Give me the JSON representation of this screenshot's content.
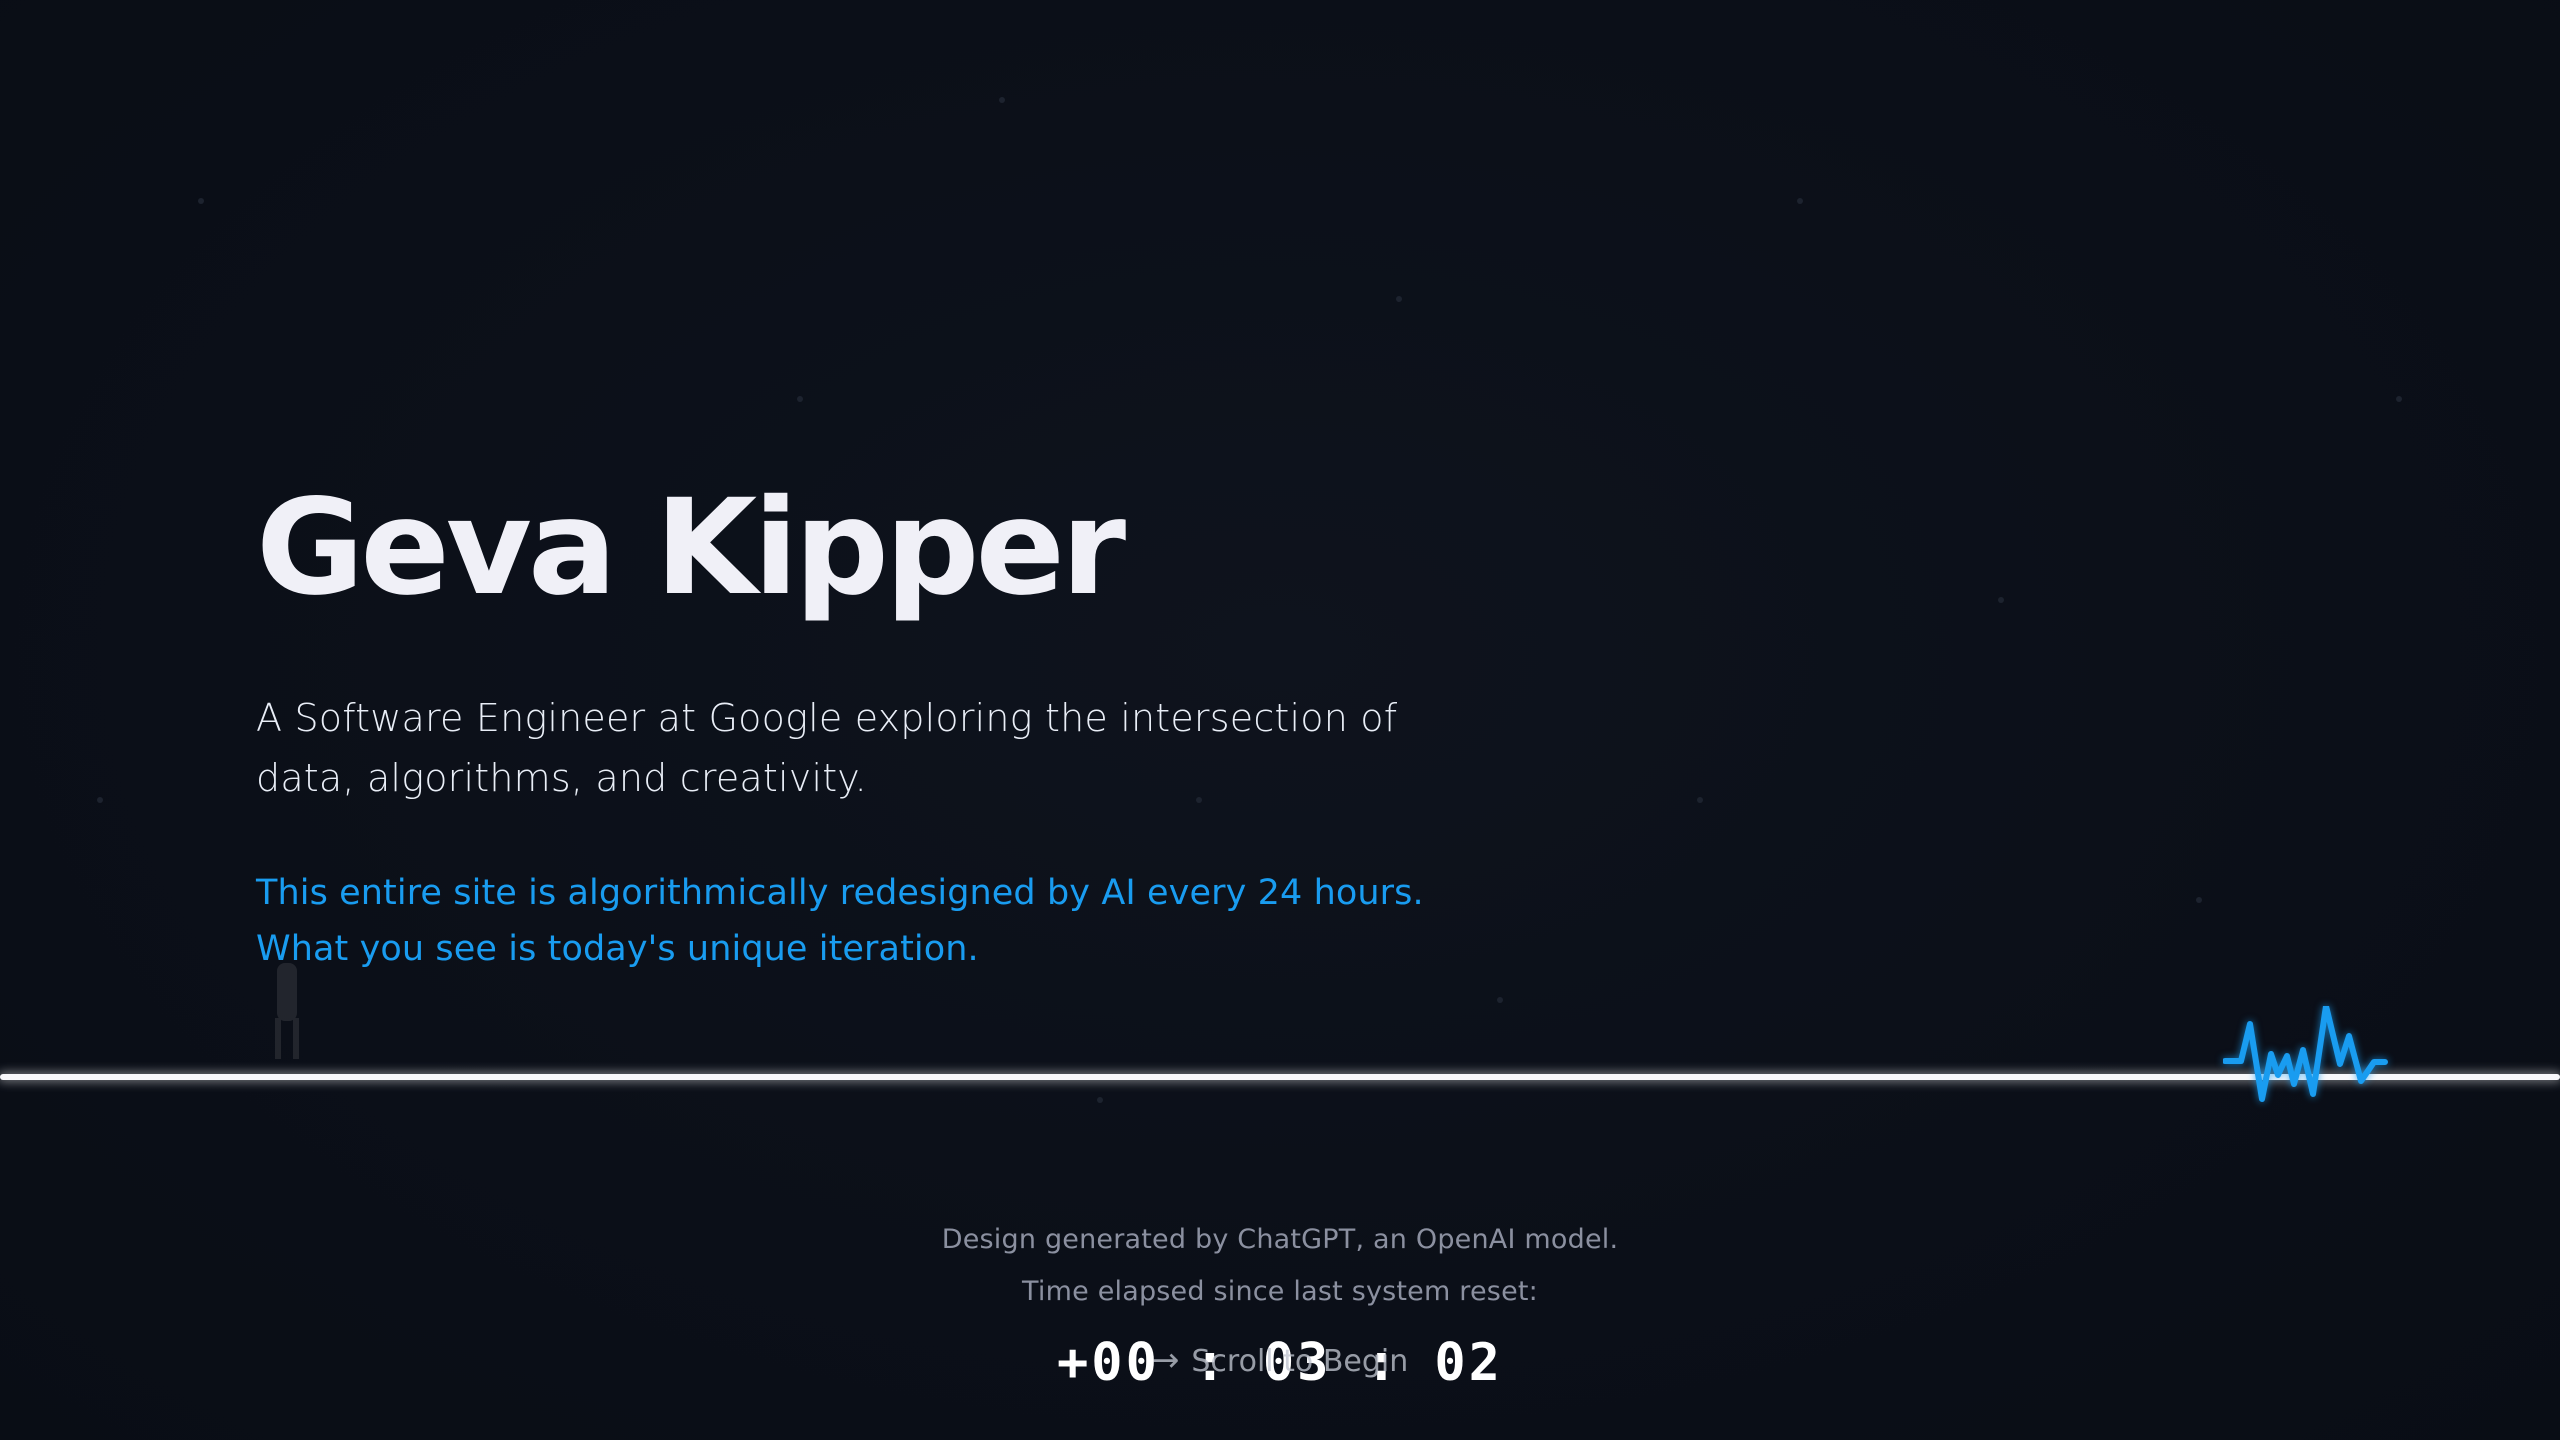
{
  "hero": {
    "name": "Geva Kipper",
    "subtitle": "A Software Engineer at Google exploring the intersection of data, algorithms, and creativity.",
    "ai_note_line1": "This entire site is algorithmically redesigned by AI every 24 hours.",
    "ai_note_line2": "What you see is today's unique iteration."
  },
  "footer": {
    "credit": "Design generated by ChatGPT, an OpenAI model.",
    "elapsed_label": "Time elapsed since last system reset:",
    "timer": "+00 : 03 : 02",
    "scroll_label": "Scroll to Begin",
    "scroll_icon": "arrow-right-icon"
  },
  "icons": {
    "pulse": "pulse-wave-icon"
  },
  "colors": {
    "background": "#0b0f18",
    "accent": "#199cf0",
    "text": "#f0f0f7",
    "muted": "#8b90a0"
  }
}
